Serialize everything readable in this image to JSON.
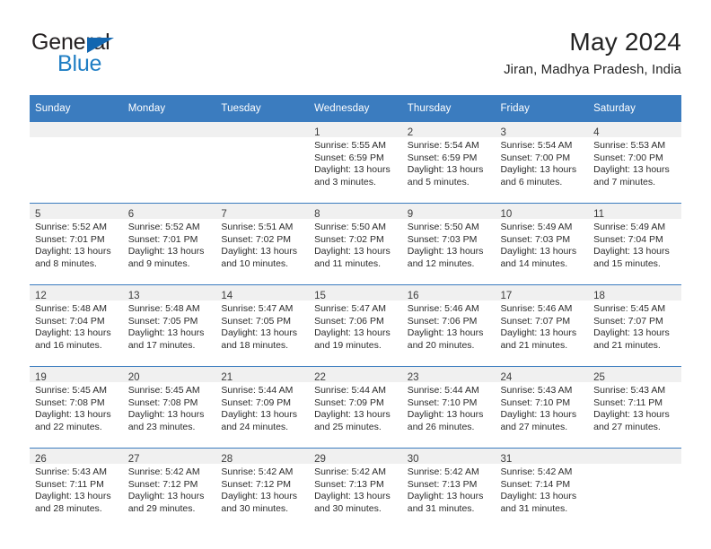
{
  "logo": {
    "word_one": "General",
    "word_two": "Blue",
    "triangle_color": "#1266b0",
    "blue_color": "#1f7ec4"
  },
  "header": {
    "title": "May 2024",
    "subtitle": "Jiran, Madhya Pradesh, India"
  },
  "theme": {
    "header_bg": "#3b7cbf",
    "header_text": "#ffffff",
    "daynum_band_bg": "#f0f0f0",
    "row_border": "#3b7cbf"
  },
  "weekday_headers": [
    "Sunday",
    "Monday",
    "Tuesday",
    "Wednesday",
    "Thursday",
    "Friday",
    "Saturday"
  ],
  "weeks": [
    [
      {
        "day": "",
        "sunrise": "",
        "sunset": "",
        "daylight_line1": "",
        "daylight_line2": ""
      },
      {
        "day": "",
        "sunrise": "",
        "sunset": "",
        "daylight_line1": "",
        "daylight_line2": ""
      },
      {
        "day": "",
        "sunrise": "",
        "sunset": "",
        "daylight_line1": "",
        "daylight_line2": ""
      },
      {
        "day": "1",
        "sunrise": "Sunrise: 5:55 AM",
        "sunset": "Sunset: 6:59 PM",
        "daylight_line1": "Daylight: 13 hours",
        "daylight_line2": "and 3 minutes."
      },
      {
        "day": "2",
        "sunrise": "Sunrise: 5:54 AM",
        "sunset": "Sunset: 6:59 PM",
        "daylight_line1": "Daylight: 13 hours",
        "daylight_line2": "and 5 minutes."
      },
      {
        "day": "3",
        "sunrise": "Sunrise: 5:54 AM",
        "sunset": "Sunset: 7:00 PM",
        "daylight_line1": "Daylight: 13 hours",
        "daylight_line2": "and 6 minutes."
      },
      {
        "day": "4",
        "sunrise": "Sunrise: 5:53 AM",
        "sunset": "Sunset: 7:00 PM",
        "daylight_line1": "Daylight: 13 hours",
        "daylight_line2": "and 7 minutes."
      }
    ],
    [
      {
        "day": "5",
        "sunrise": "Sunrise: 5:52 AM",
        "sunset": "Sunset: 7:01 PM",
        "daylight_line1": "Daylight: 13 hours",
        "daylight_line2": "and 8 minutes."
      },
      {
        "day": "6",
        "sunrise": "Sunrise: 5:52 AM",
        "sunset": "Sunset: 7:01 PM",
        "daylight_line1": "Daylight: 13 hours",
        "daylight_line2": "and 9 minutes."
      },
      {
        "day": "7",
        "sunrise": "Sunrise: 5:51 AM",
        "sunset": "Sunset: 7:02 PM",
        "daylight_line1": "Daylight: 13 hours",
        "daylight_line2": "and 10 minutes."
      },
      {
        "day": "8",
        "sunrise": "Sunrise: 5:50 AM",
        "sunset": "Sunset: 7:02 PM",
        "daylight_line1": "Daylight: 13 hours",
        "daylight_line2": "and 11 minutes."
      },
      {
        "day": "9",
        "sunrise": "Sunrise: 5:50 AM",
        "sunset": "Sunset: 7:03 PM",
        "daylight_line1": "Daylight: 13 hours",
        "daylight_line2": "and 12 minutes."
      },
      {
        "day": "10",
        "sunrise": "Sunrise: 5:49 AM",
        "sunset": "Sunset: 7:03 PM",
        "daylight_line1": "Daylight: 13 hours",
        "daylight_line2": "and 14 minutes."
      },
      {
        "day": "11",
        "sunrise": "Sunrise: 5:49 AM",
        "sunset": "Sunset: 7:04 PM",
        "daylight_line1": "Daylight: 13 hours",
        "daylight_line2": "and 15 minutes."
      }
    ],
    [
      {
        "day": "12",
        "sunrise": "Sunrise: 5:48 AM",
        "sunset": "Sunset: 7:04 PM",
        "daylight_line1": "Daylight: 13 hours",
        "daylight_line2": "and 16 minutes."
      },
      {
        "day": "13",
        "sunrise": "Sunrise: 5:48 AM",
        "sunset": "Sunset: 7:05 PM",
        "daylight_line1": "Daylight: 13 hours",
        "daylight_line2": "and 17 minutes."
      },
      {
        "day": "14",
        "sunrise": "Sunrise: 5:47 AM",
        "sunset": "Sunset: 7:05 PM",
        "daylight_line1": "Daylight: 13 hours",
        "daylight_line2": "and 18 minutes."
      },
      {
        "day": "15",
        "sunrise": "Sunrise: 5:47 AM",
        "sunset": "Sunset: 7:06 PM",
        "daylight_line1": "Daylight: 13 hours",
        "daylight_line2": "and 19 minutes."
      },
      {
        "day": "16",
        "sunrise": "Sunrise: 5:46 AM",
        "sunset": "Sunset: 7:06 PM",
        "daylight_line1": "Daylight: 13 hours",
        "daylight_line2": "and 20 minutes."
      },
      {
        "day": "17",
        "sunrise": "Sunrise: 5:46 AM",
        "sunset": "Sunset: 7:07 PM",
        "daylight_line1": "Daylight: 13 hours",
        "daylight_line2": "and 21 minutes."
      },
      {
        "day": "18",
        "sunrise": "Sunrise: 5:45 AM",
        "sunset": "Sunset: 7:07 PM",
        "daylight_line1": "Daylight: 13 hours",
        "daylight_line2": "and 21 minutes."
      }
    ],
    [
      {
        "day": "19",
        "sunrise": "Sunrise: 5:45 AM",
        "sunset": "Sunset: 7:08 PM",
        "daylight_line1": "Daylight: 13 hours",
        "daylight_line2": "and 22 minutes."
      },
      {
        "day": "20",
        "sunrise": "Sunrise: 5:45 AM",
        "sunset": "Sunset: 7:08 PM",
        "daylight_line1": "Daylight: 13 hours",
        "daylight_line2": "and 23 minutes."
      },
      {
        "day": "21",
        "sunrise": "Sunrise: 5:44 AM",
        "sunset": "Sunset: 7:09 PM",
        "daylight_line1": "Daylight: 13 hours",
        "daylight_line2": "and 24 minutes."
      },
      {
        "day": "22",
        "sunrise": "Sunrise: 5:44 AM",
        "sunset": "Sunset: 7:09 PM",
        "daylight_line1": "Daylight: 13 hours",
        "daylight_line2": "and 25 minutes."
      },
      {
        "day": "23",
        "sunrise": "Sunrise: 5:44 AM",
        "sunset": "Sunset: 7:10 PM",
        "daylight_line1": "Daylight: 13 hours",
        "daylight_line2": "and 26 minutes."
      },
      {
        "day": "24",
        "sunrise": "Sunrise: 5:43 AM",
        "sunset": "Sunset: 7:10 PM",
        "daylight_line1": "Daylight: 13 hours",
        "daylight_line2": "and 27 minutes."
      },
      {
        "day": "25",
        "sunrise": "Sunrise: 5:43 AM",
        "sunset": "Sunset: 7:11 PM",
        "daylight_line1": "Daylight: 13 hours",
        "daylight_line2": "and 27 minutes."
      }
    ],
    [
      {
        "day": "26",
        "sunrise": "Sunrise: 5:43 AM",
        "sunset": "Sunset: 7:11 PM",
        "daylight_line1": "Daylight: 13 hours",
        "daylight_line2": "and 28 minutes."
      },
      {
        "day": "27",
        "sunrise": "Sunrise: 5:42 AM",
        "sunset": "Sunset: 7:12 PM",
        "daylight_line1": "Daylight: 13 hours",
        "daylight_line2": "and 29 minutes."
      },
      {
        "day": "28",
        "sunrise": "Sunrise: 5:42 AM",
        "sunset": "Sunset: 7:12 PM",
        "daylight_line1": "Daylight: 13 hours",
        "daylight_line2": "and 30 minutes."
      },
      {
        "day": "29",
        "sunrise": "Sunrise: 5:42 AM",
        "sunset": "Sunset: 7:13 PM",
        "daylight_line1": "Daylight: 13 hours",
        "daylight_line2": "and 30 minutes."
      },
      {
        "day": "30",
        "sunrise": "Sunrise: 5:42 AM",
        "sunset": "Sunset: 7:13 PM",
        "daylight_line1": "Daylight: 13 hours",
        "daylight_line2": "and 31 minutes."
      },
      {
        "day": "31",
        "sunrise": "Sunrise: 5:42 AM",
        "sunset": "Sunset: 7:14 PM",
        "daylight_line1": "Daylight: 13 hours",
        "daylight_line2": "and 31 minutes."
      },
      {
        "day": "",
        "sunrise": "",
        "sunset": "",
        "daylight_line1": "",
        "daylight_line2": ""
      }
    ]
  ]
}
